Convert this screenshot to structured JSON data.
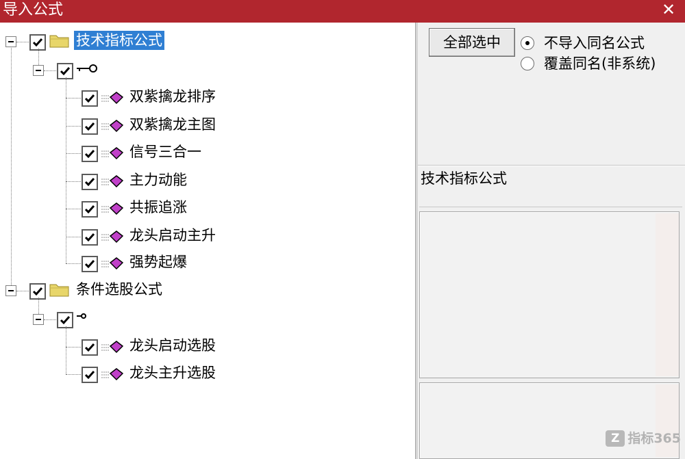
{
  "window": {
    "title": "导入公式",
    "close_glyph": "✕"
  },
  "tree": {
    "groups": [
      {
        "label": "技术指标公式",
        "selected": true,
        "checked": true,
        "subgroup_checked": true,
        "items": [
          {
            "label": "双紫擒龙排序",
            "checked": true
          },
          {
            "label": "双紫擒龙主图",
            "checked": true
          },
          {
            "label": "信号三合一",
            "checked": true
          },
          {
            "label": "主力动能",
            "checked": true
          },
          {
            "label": "共振追涨",
            "checked": true
          },
          {
            "label": "龙头启动主升",
            "checked": true
          },
          {
            "label": "强势起爆",
            "checked": true
          }
        ]
      },
      {
        "label": "条件选股公式",
        "selected": false,
        "checked": true,
        "subgroup_checked": true,
        "items": [
          {
            "label": "龙头启动选股",
            "checked": true
          },
          {
            "label": "龙头主升选股",
            "checked": true
          }
        ]
      }
    ]
  },
  "controls": {
    "select_all_label": "全部选中",
    "radio_options": [
      {
        "label": "不导入同名公式",
        "selected": true
      },
      {
        "label": "覆盖同名(非系统)",
        "selected": false
      }
    ]
  },
  "detail": {
    "formula_name": "技术指标公式"
  },
  "watermark": {
    "logo_text": "Z",
    "text": "指标365"
  },
  "colors": {
    "titlebar": "#b1262e",
    "selection": "#2f7fd3",
    "item_icon": "#c040c8",
    "folder": "#e8d66a"
  }
}
